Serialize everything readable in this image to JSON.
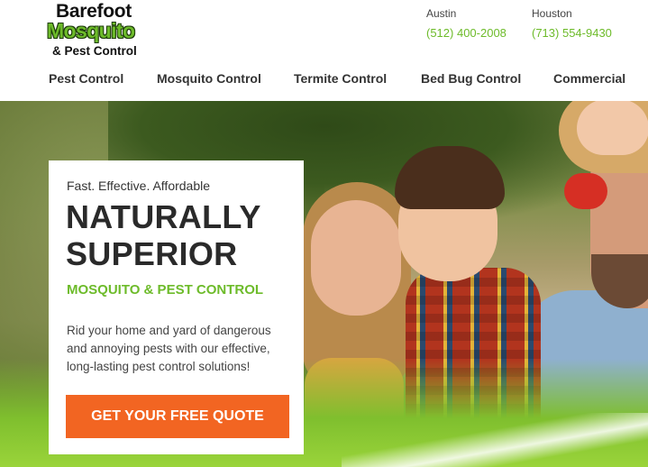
{
  "header": {
    "logo": {
      "line1": "Barefoot",
      "line2": "Mosquito",
      "line3": "& Pest Control",
      "brand_green": "#6dbb2a"
    },
    "contacts": [
      {
        "city": "Austin",
        "phone": "(512) 400-2008"
      },
      {
        "city": "Houston",
        "phone": "(713) 554-9430"
      }
    ]
  },
  "nav": {
    "items": [
      {
        "label": "Pest Control"
      },
      {
        "label": "Mosquito Control"
      },
      {
        "label": "Termite Control"
      },
      {
        "label": "Bed Bug Control"
      },
      {
        "label": "Commercial"
      }
    ]
  },
  "hero": {
    "tagline": "Fast. Effective. Affordable",
    "headline_line1": "NATURALLY",
    "headline_line2": "SUPERIOR",
    "subheadline": "MOSQUITO & PEST CONTROL",
    "description": "Rid your home and yard of dangerous and annoying pests with our effective, long-lasting pest control solutions!",
    "cta_label": "GET YOUR FREE QUOTE",
    "cta_color": "#f26522"
  }
}
